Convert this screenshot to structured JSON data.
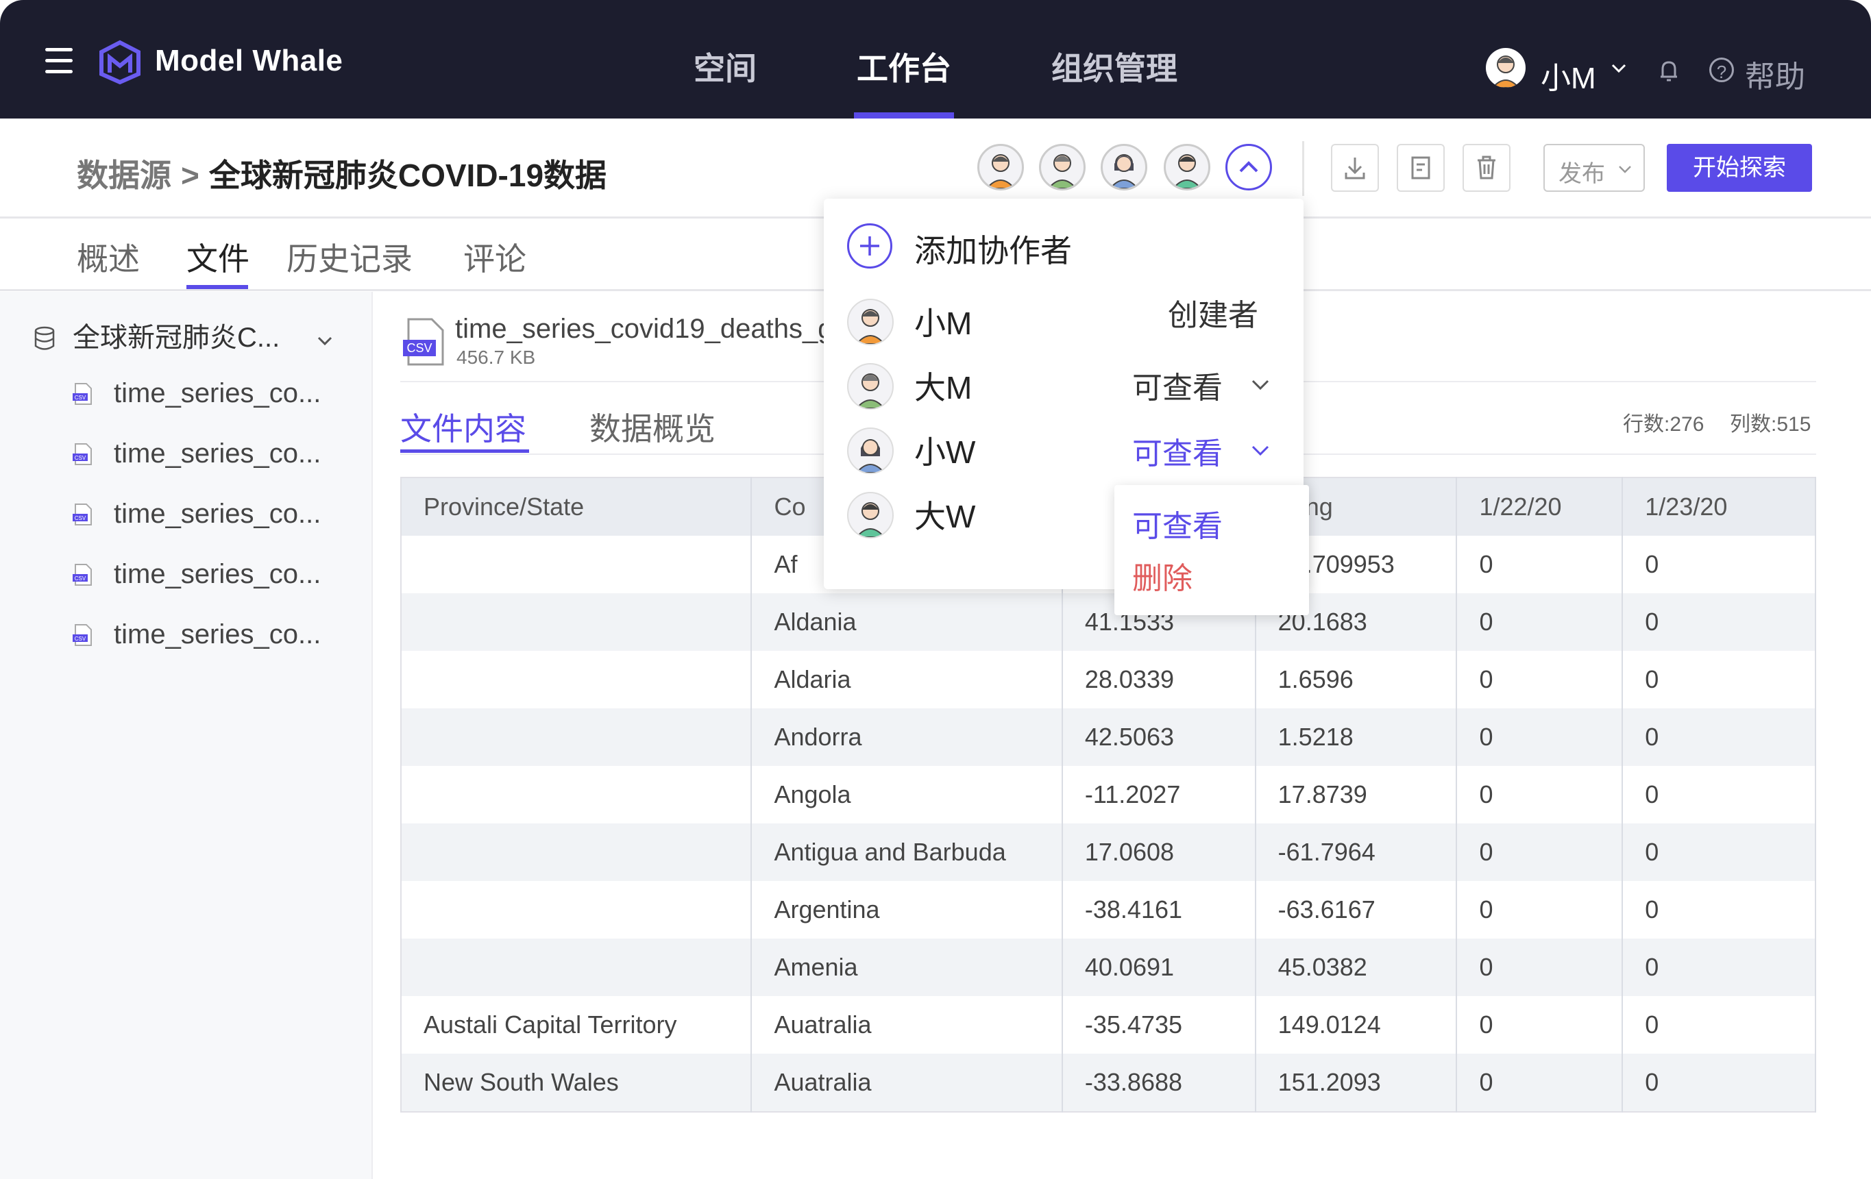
{
  "header": {
    "brand": "Model Whale",
    "nav": [
      "空间",
      "工作台",
      "组织管理"
    ],
    "active_nav": "工作台",
    "user": "小M",
    "help": "帮助",
    "accent": "#5a4be8"
  },
  "page": {
    "breadcrumb_root": "数据源",
    "breadcrumb_sep": ">",
    "title": "全球新冠肺炎COVID-19数据",
    "publish_label": "发布",
    "explore_label": "开始探索",
    "tabs": [
      "概述",
      "文件",
      "历史记录",
      "评论"
    ],
    "active_tab": "文件"
  },
  "sidebar": {
    "root": "全球新冠肺炎C...",
    "files": [
      "time_series_co...",
      "time_series_co...",
      "time_series_co...",
      "time_series_co...",
      "time_series_co..."
    ]
  },
  "file": {
    "badge": "CSV",
    "name": "time_series_covid19_deaths_g",
    "size": "456.7 KB",
    "tabs": [
      "文件内容",
      "数据概览"
    ],
    "rows_label": "行数:276",
    "cols_label": "列数:515"
  },
  "table": {
    "headers": [
      "Province/State",
      "Co",
      "",
      "Long",
      "1/22/20",
      "1/23/20"
    ],
    "rows": [
      [
        "",
        "Af",
        "",
        "67.709953",
        "0",
        "0"
      ],
      [
        "",
        "Aldania",
        "41.1533",
        "20.1683",
        "0",
        "0"
      ],
      [
        "",
        "Aldaria",
        "28.0339",
        "1.6596",
        "0",
        "0"
      ],
      [
        "",
        "Andorra",
        "42.5063",
        "1.5218",
        "0",
        "0"
      ],
      [
        "",
        "Angola",
        "-11.2027",
        "17.8739",
        "0",
        "0"
      ],
      [
        "",
        "Antigua and Barbuda",
        "17.0608",
        "-61.7964",
        "0",
        "0"
      ],
      [
        "",
        "Argentina",
        "-38.4161",
        "-63.6167",
        "0",
        "0"
      ],
      [
        "",
        "Amenia",
        "40.0691",
        "45.0382",
        "0",
        "0"
      ],
      [
        "Austali Capital Territory",
        "Auatralia",
        "-35.4735",
        "149.0124",
        "0",
        "0"
      ],
      [
        "New South Wales",
        "Auatralia",
        "-33.8688",
        "151.2093",
        "0",
        "0"
      ]
    ]
  },
  "collaborators": {
    "add_label": "添加协作者",
    "members": [
      {
        "name": "小M",
        "role": "创建者"
      },
      {
        "name": "大M",
        "role": "可查看"
      },
      {
        "name": "小W",
        "role": "可查看"
      },
      {
        "name": "大W",
        "role": ""
      }
    ]
  },
  "role_menu": {
    "options": [
      "可查看",
      "删除"
    ],
    "danger_color": "#e05c5c"
  }
}
